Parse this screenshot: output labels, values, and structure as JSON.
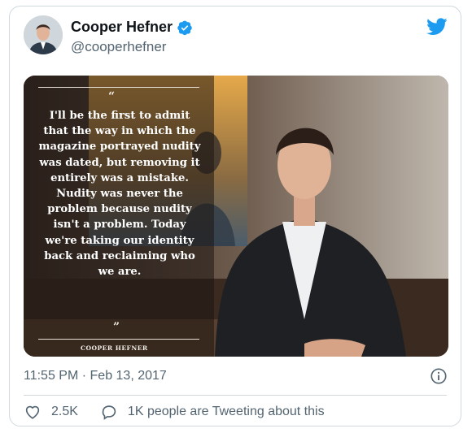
{
  "tweet": {
    "author": {
      "display_name": "Cooper Hefner",
      "handle": "@cooperhefner",
      "verified": true,
      "avatar_icon": "profile-photo"
    },
    "logo_icon": "twitter-bird-icon",
    "media": {
      "quote_text": "I'll be the first to admit that the way in which the magazine portrayed nudity was dated, but removing it entirely was a mistake. Nudity was never the problem because nudity isn't a problem. Today we're taking our identity back and reclaiming who we are.",
      "open_quote": "“",
      "close_quote": "”",
      "attribution": "COOPER HEFNER"
    },
    "timestamp": "11:55 PM · Feb 13, 2017",
    "likes": "2.5K",
    "tweeting_text": "1K people are Tweeting about this",
    "accent_color": "#1d9bf0"
  }
}
